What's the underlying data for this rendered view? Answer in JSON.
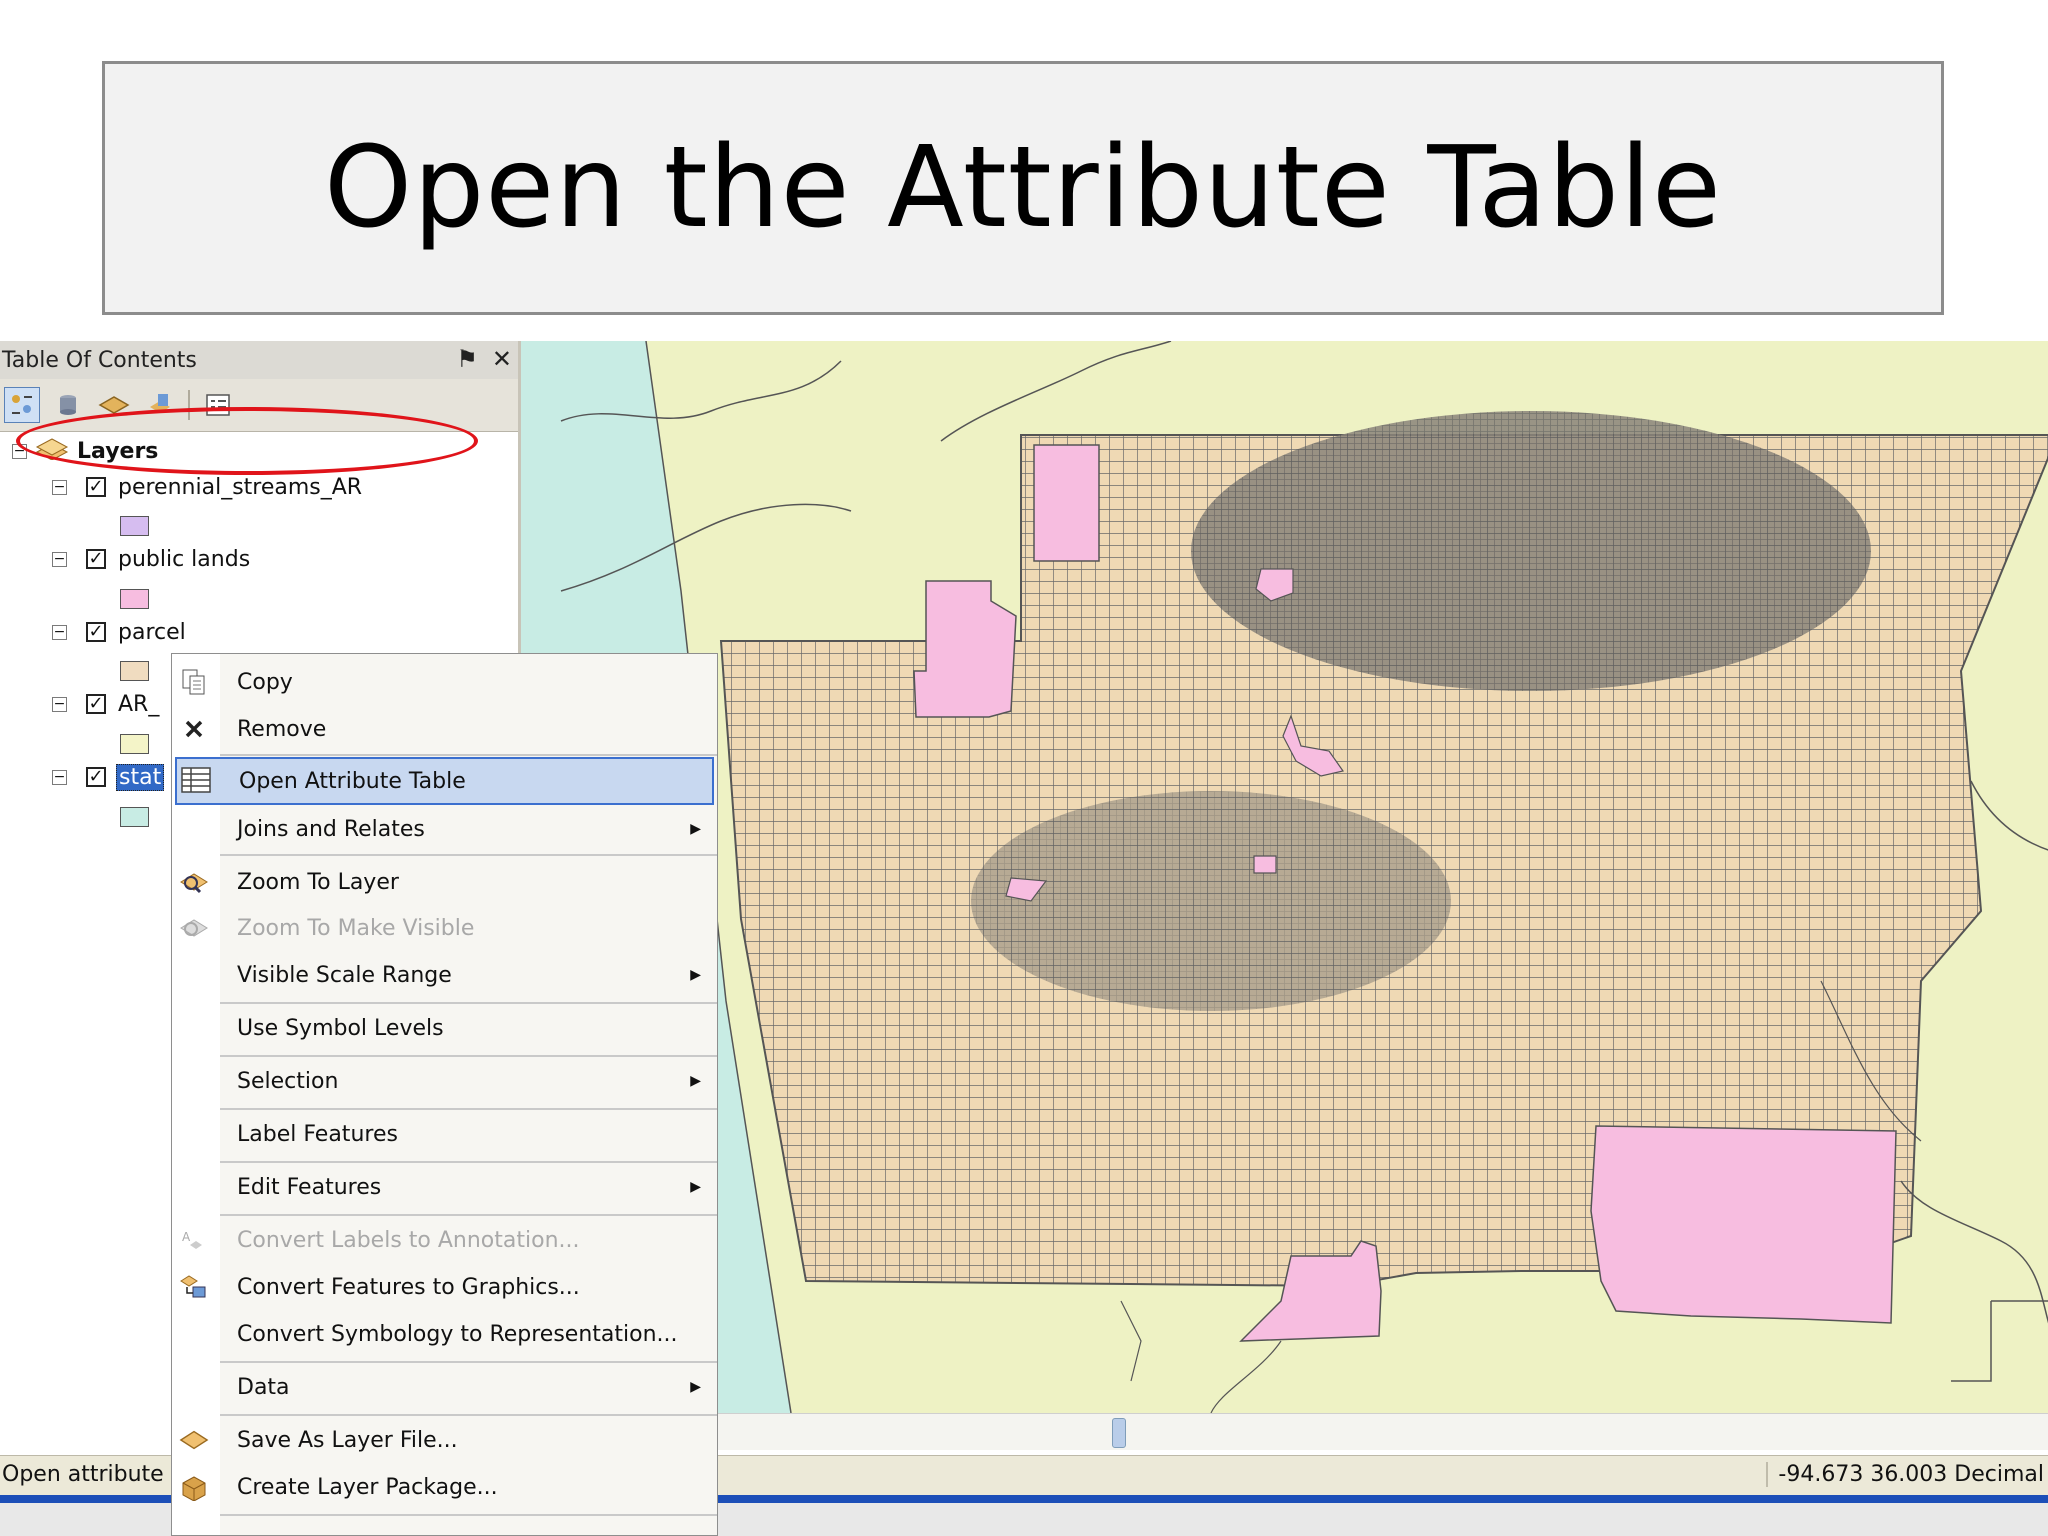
{
  "slide": {
    "title": "Open the Attribute Table"
  },
  "toc": {
    "header": "Table Of Contents",
    "pin_icon": "⚑",
    "close_icon": "✕",
    "root_label": "Layers",
    "layers": [
      {
        "label": "perennial_streams_AR",
        "checked": true,
        "swatch": "#d6bdf0"
      },
      {
        "label": "public lands",
        "checked": true,
        "swatch": "#f7bde0"
      },
      {
        "label": "parcel",
        "checked": true,
        "swatch": "#f0dcc0"
      },
      {
        "label": "AR_",
        "checked": true,
        "swatch": "#f4f4c8"
      },
      {
        "label": "stat",
        "checked": true,
        "swatch": "#c8ece4"
      }
    ]
  },
  "context_menu": {
    "items": [
      {
        "label": "Copy",
        "icon": "copy-icon"
      },
      {
        "label": "Remove",
        "icon": "remove-icon"
      },
      {
        "label": "Open Attribute Table",
        "icon": "table-icon",
        "highlighted": true
      },
      {
        "label": "Joins and Relates",
        "submenu": true
      },
      {
        "label": "Zoom To Layer",
        "icon": "zoom-layer-icon"
      },
      {
        "label": "Zoom To Make Visible",
        "icon": "zoom-visible-icon",
        "disabled": true
      },
      {
        "label": "Visible Scale Range",
        "submenu": true
      },
      {
        "label": "Use Symbol Levels"
      },
      {
        "label": "Selection",
        "submenu": true
      },
      {
        "label": "Label Features"
      },
      {
        "label": "Edit Features",
        "submenu": true
      },
      {
        "label": "Convert Labels to Annotation...",
        "icon": "convert-labels-icon",
        "disabled": true
      },
      {
        "label": "Convert Features to Graphics...",
        "icon": "convert-graphics-icon"
      },
      {
        "label": "Convert Symbology to Representation..."
      },
      {
        "label": "Data",
        "submenu": true
      },
      {
        "label": "Save As Layer File...",
        "icon": "layer-file-icon"
      },
      {
        "label": "Create Layer Package...",
        "icon": "layer-package-icon"
      }
    ]
  },
  "status_bar": {
    "left_text": "Open attribute ta",
    "coordinates": "-94.673  36.003 Decimal"
  },
  "colors": {
    "menu_highlight": "#c8d8f0",
    "ellipse": "#e0141a",
    "parcel_fill": "#efd9b4",
    "public_lands": "#f7bde0",
    "water": "#c8ece4",
    "background_land": "#eef2c4"
  }
}
